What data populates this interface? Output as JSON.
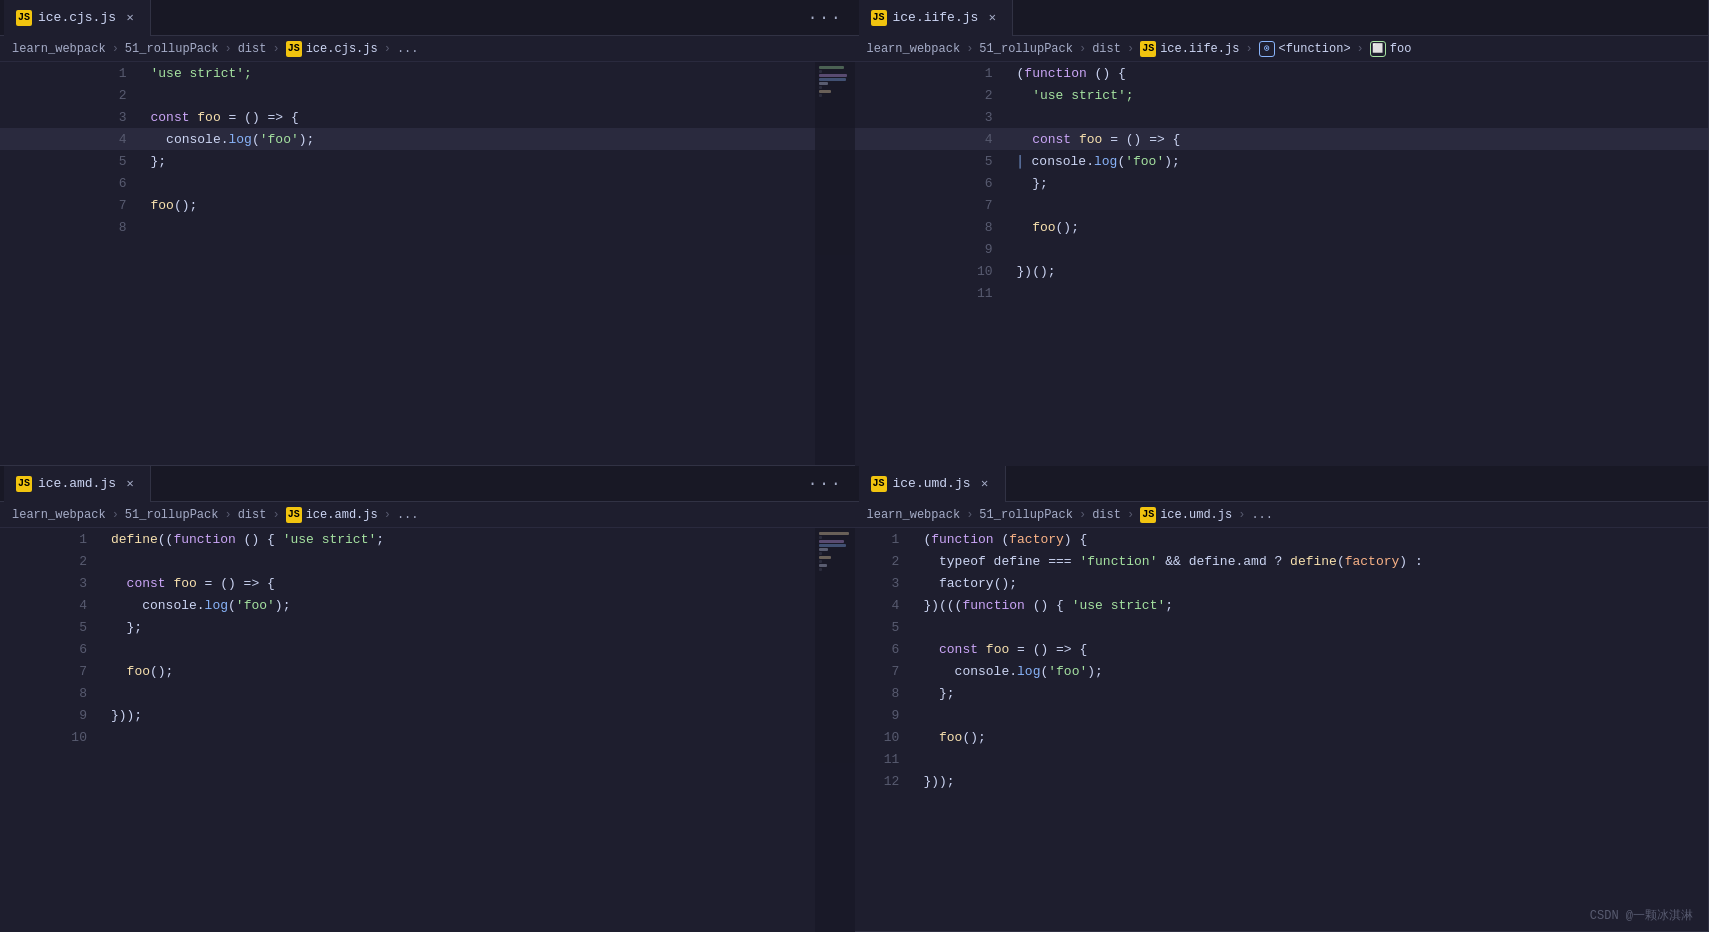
{
  "colors": {
    "bg": "#1e1e2e",
    "tabBar": "#181825",
    "border": "#313244",
    "lineNum": "#585b70",
    "active": "#2a2a3e",
    "keyword": "#cba6f7",
    "string": "#a6e3a1",
    "fn": "#89b4fa",
    "var": "#f9e2af",
    "punc": "#cdd6f4",
    "comment": "#585b70"
  },
  "pane1": {
    "tab_label": "ice.cjs.js",
    "breadcrumb": "learn_webpack > 51_rollupPack > dist > JS ice.cjs.js > ...",
    "lines": [
      {
        "num": 1,
        "tokens": [
          {
            "t": "  'use strict';",
            "c": "green"
          }
        ]
      },
      {
        "num": 2,
        "tokens": []
      },
      {
        "num": 3,
        "tokens": [
          {
            "t": "const ",
            "c": "purple"
          },
          {
            "t": "foo",
            "c": "yellow"
          },
          {
            "t": " = () => {",
            "c": "white"
          }
        ]
      },
      {
        "num": 4,
        "tokens": [
          {
            "t": "  console",
            "c": "white"
          },
          {
            "t": ".",
            "c": "white"
          },
          {
            "t": "log",
            "c": "blue"
          },
          {
            "t": "(",
            "c": "white"
          },
          {
            "t": "'foo'",
            "c": "green"
          },
          {
            "t": ");",
            "c": "white"
          }
        ],
        "active": true
      },
      {
        "num": 5,
        "tokens": [
          {
            "t": "};",
            "c": "white"
          }
        ]
      },
      {
        "num": 6,
        "tokens": []
      },
      {
        "num": 7,
        "tokens": [
          {
            "t": "foo",
            "c": "yellow"
          },
          {
            "t": "();",
            "c": "white"
          }
        ]
      },
      {
        "num": 8,
        "tokens": []
      }
    ]
  },
  "pane2": {
    "tab_label": "ice.iife.js",
    "breadcrumb": "learn_webpack > 51_rollupPack > dist > JS ice.iife.js > ⊙ <function> > ⬜ foo",
    "lines": [
      {
        "num": 1,
        "tokens": [
          {
            "t": "(",
            "c": "white"
          },
          {
            "t": "function",
            "c": "purple"
          },
          {
            "t": " () {",
            "c": "white"
          }
        ]
      },
      {
        "num": 2,
        "tokens": [
          {
            "t": "  'use strict';",
            "c": "green"
          }
        ]
      },
      {
        "num": 3,
        "tokens": []
      },
      {
        "num": 4,
        "tokens": [
          {
            "t": "  ",
            "c": "white"
          },
          {
            "t": "const ",
            "c": "purple"
          },
          {
            "t": "foo",
            "c": "yellow"
          },
          {
            "t": " = () => {",
            "c": "white"
          }
        ],
        "active": true
      },
      {
        "num": 5,
        "tokens": [
          {
            "t": "  | console",
            "c": "white"
          },
          {
            "t": ".",
            "c": "white"
          },
          {
            "t": "log",
            "c": "blue"
          },
          {
            "t": "(",
            "c": "white"
          },
          {
            "t": "'foo'",
            "c": "green"
          },
          {
            "t": ");",
            "c": "white"
          }
        ]
      },
      {
        "num": 6,
        "tokens": [
          {
            "t": "  };",
            "c": "white"
          }
        ]
      },
      {
        "num": 7,
        "tokens": []
      },
      {
        "num": 8,
        "tokens": [
          {
            "t": "  foo",
            "c": "yellow"
          },
          {
            "t": "();",
            "c": "white"
          }
        ]
      },
      {
        "num": 9,
        "tokens": []
      },
      {
        "num": 10,
        "tokens": [
          {
            "t": "})(",
            "c": "white"
          },
          {
            "t": ");",
            "c": "white"
          }
        ]
      },
      {
        "num": 11,
        "tokens": []
      }
    ]
  },
  "pane3": {
    "tab_label": "ice.amd.js",
    "breadcrumb": "learn_webpack > 51_rollupPack > dist > JS ice.amd.js > ...",
    "lines": [
      {
        "num": 1,
        "tokens": [
          {
            "t": "define",
            "c": "yellow"
          },
          {
            "t": "((",
            "c": "white"
          },
          {
            "t": "function",
            "c": "purple"
          },
          {
            "t": " () { ",
            "c": "white"
          },
          {
            "t": "'use strict'",
            "c": "green"
          },
          {
            "t": ";",
            "c": "white"
          }
        ]
      },
      {
        "num": 2,
        "tokens": []
      },
      {
        "num": 3,
        "tokens": [
          {
            "t": "  ",
            "c": "white"
          },
          {
            "t": "const ",
            "c": "purple"
          },
          {
            "t": "foo",
            "c": "yellow"
          },
          {
            "t": " = () => {",
            "c": "white"
          }
        ]
      },
      {
        "num": 4,
        "tokens": [
          {
            "t": "    console",
            "c": "white"
          },
          {
            "t": ".",
            "c": "white"
          },
          {
            "t": "log",
            "c": "blue"
          },
          {
            "t": "(",
            "c": "white"
          },
          {
            "t": "'foo'",
            "c": "green"
          },
          {
            "t": ");",
            "c": "white"
          }
        ]
      },
      {
        "num": 5,
        "tokens": [
          {
            "t": "  };",
            "c": "white"
          }
        ]
      },
      {
        "num": 6,
        "tokens": []
      },
      {
        "num": 7,
        "tokens": [
          {
            "t": "  foo",
            "c": "yellow"
          },
          {
            "t": "();",
            "c": "white"
          }
        ]
      },
      {
        "num": 8,
        "tokens": []
      },
      {
        "num": 9,
        "tokens": [
          {
            "t": "}));",
            "c": "white"
          }
        ]
      },
      {
        "num": 10,
        "tokens": []
      }
    ]
  },
  "pane4": {
    "tab_label": "ice.umd.js",
    "breadcrumb": "learn_webpack > 51_rollupPack > dist > JS ice.umd.js > ...",
    "lines": [
      {
        "num": 1,
        "tokens": [
          {
            "t": "(",
            "c": "white"
          },
          {
            "t": "function",
            "c": "purple"
          },
          {
            "t": " (",
            "c": "white"
          },
          {
            "t": "factory",
            "c": "orange"
          },
          {
            "t": ") {",
            "c": "white"
          }
        ]
      },
      {
        "num": 2,
        "tokens": [
          {
            "t": "  typeof define === ",
            "c": "white"
          },
          {
            "t": "'function'",
            "c": "green"
          },
          {
            "t": " && define.",
            "c": "white"
          },
          {
            "t": "amd",
            "c": "white"
          },
          {
            "t": " ? ",
            "c": "white"
          },
          {
            "t": "define",
            "c": "yellow"
          },
          {
            "t": "(",
            "c": "white"
          },
          {
            "t": "factory",
            "c": "orange"
          },
          {
            "t": ") :",
            "c": "white"
          }
        ]
      },
      {
        "num": 3,
        "tokens": [
          {
            "t": "  factory",
            "c": "white"
          },
          {
            "t": "();",
            "c": "white"
          }
        ]
      },
      {
        "num": 4,
        "tokens": [
          {
            "t": "})(((",
            "c": "white"
          },
          {
            "t": "function",
            "c": "purple"
          },
          {
            "t": " () { ",
            "c": "white"
          },
          {
            "t": "'use strict'",
            "c": "green"
          },
          {
            "t": ";",
            "c": "white"
          }
        ]
      },
      {
        "num": 5,
        "tokens": []
      },
      {
        "num": 6,
        "tokens": [
          {
            "t": "  ",
            "c": "white"
          },
          {
            "t": "const ",
            "c": "purple"
          },
          {
            "t": "foo",
            "c": "yellow"
          },
          {
            "t": " = () => {",
            "c": "white"
          }
        ]
      },
      {
        "num": 7,
        "tokens": [
          {
            "t": "    console",
            "c": "white"
          },
          {
            "t": ".",
            "c": "white"
          },
          {
            "t": "log",
            "c": "blue"
          },
          {
            "t": "(",
            "c": "white"
          },
          {
            "t": "'foo'",
            "c": "green"
          },
          {
            "t": ");",
            "c": "white"
          }
        ]
      },
      {
        "num": 8,
        "tokens": [
          {
            "t": "  };",
            "c": "white"
          }
        ]
      },
      {
        "num": 9,
        "tokens": []
      },
      {
        "num": 10,
        "tokens": [
          {
            "t": "  foo",
            "c": "yellow"
          },
          {
            "t": "();",
            "c": "white"
          }
        ]
      },
      {
        "num": 11,
        "tokens": []
      },
      {
        "num": 12,
        "tokens": [
          {
            "t": "}));",
            "c": "white"
          }
        ]
      }
    ]
  },
  "watermark": "CSDN @一颗冰淇淋"
}
